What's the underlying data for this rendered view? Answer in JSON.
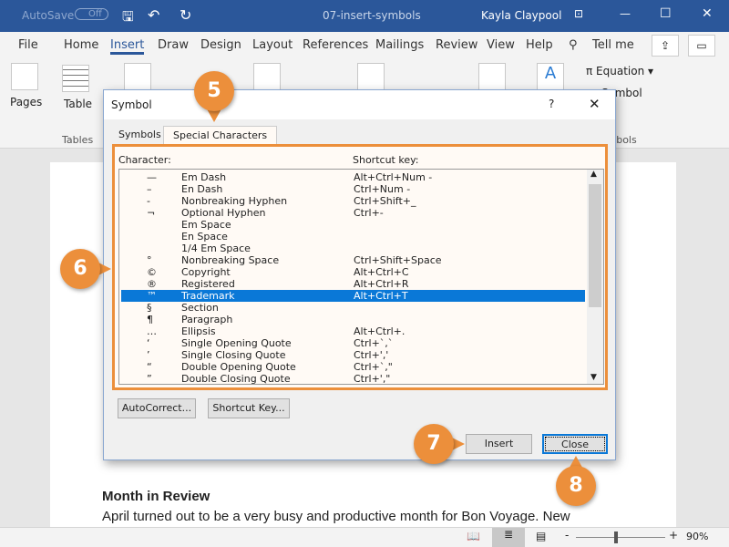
{
  "titlebar": {
    "autosave": "AutoSave",
    "autosave_state": "Off",
    "doc_title": "07-insert-symbols",
    "user": "Kayla Claypool"
  },
  "tabs": [
    "File",
    "Home",
    "Insert",
    "Draw",
    "Design",
    "Layout",
    "References",
    "Mailings",
    "Review",
    "View",
    "Help"
  ],
  "tell_me": "Tell me",
  "ribbon": {
    "pages": "Pages",
    "table": "Table",
    "tables_group": "Tables",
    "equation": "Equation",
    "symbol": "Symbol",
    "symbols_group": "Symbols"
  },
  "dialog": {
    "title": "Symbol",
    "help": "?",
    "tabs": [
      "Symbols",
      "Special Characters"
    ],
    "col_character": "Character:",
    "col_shortcut": "Shortcut key:",
    "rows": [
      {
        "char": "—",
        "name": "Em Dash",
        "key": "Alt+Ctrl+Num -"
      },
      {
        "char": "–",
        "name": "En Dash",
        "key": "Ctrl+Num -"
      },
      {
        "char": "-",
        "name": "Nonbreaking Hyphen",
        "key": "Ctrl+Shift+_"
      },
      {
        "char": "¬",
        "name": "Optional Hyphen",
        "key": "Ctrl+-"
      },
      {
        "char": "",
        "name": "Em Space",
        "key": ""
      },
      {
        "char": "",
        "name": "En Space",
        "key": ""
      },
      {
        "char": "",
        "name": "1/4 Em Space",
        "key": ""
      },
      {
        "char": "°",
        "name": "Nonbreaking Space",
        "key": "Ctrl+Shift+Space"
      },
      {
        "char": "©",
        "name": "Copyright",
        "key": "Alt+Ctrl+C"
      },
      {
        "char": "®",
        "name": "Registered",
        "key": "Alt+Ctrl+R"
      },
      {
        "char": "™",
        "name": "Trademark",
        "key": "Alt+Ctrl+T",
        "selected": true
      },
      {
        "char": "§",
        "name": "Section",
        "key": ""
      },
      {
        "char": "¶",
        "name": "Paragraph",
        "key": ""
      },
      {
        "char": "…",
        "name": "Ellipsis",
        "key": "Alt+Ctrl+."
      },
      {
        "char": "‘",
        "name": "Single Opening Quote",
        "key": "Ctrl+`,`"
      },
      {
        "char": "’",
        "name": "Single Closing Quote",
        "key": "Ctrl+','"
      },
      {
        "char": "“",
        "name": "Double Opening Quote",
        "key": "Ctrl+`,\""
      },
      {
        "char": "”",
        "name": "Double Closing Quote",
        "key": "Ctrl+',\""
      }
    ],
    "autocorrect": "AutoCorrect...",
    "shortcut_key": "Shortcut Key...",
    "insert": "Insert",
    "close": "Close"
  },
  "callouts": [
    "5",
    "6",
    "7",
    "8"
  ],
  "document": {
    "heading": "Month in Review",
    "body": "April turned out to be a very busy and productive month for Bon Voyage. New"
  },
  "status": {
    "zoom": "90%"
  },
  "colors": {
    "titlebar": "#2b579a",
    "accent_orange": "#ec8f3b",
    "selection": "#0a78d7"
  }
}
